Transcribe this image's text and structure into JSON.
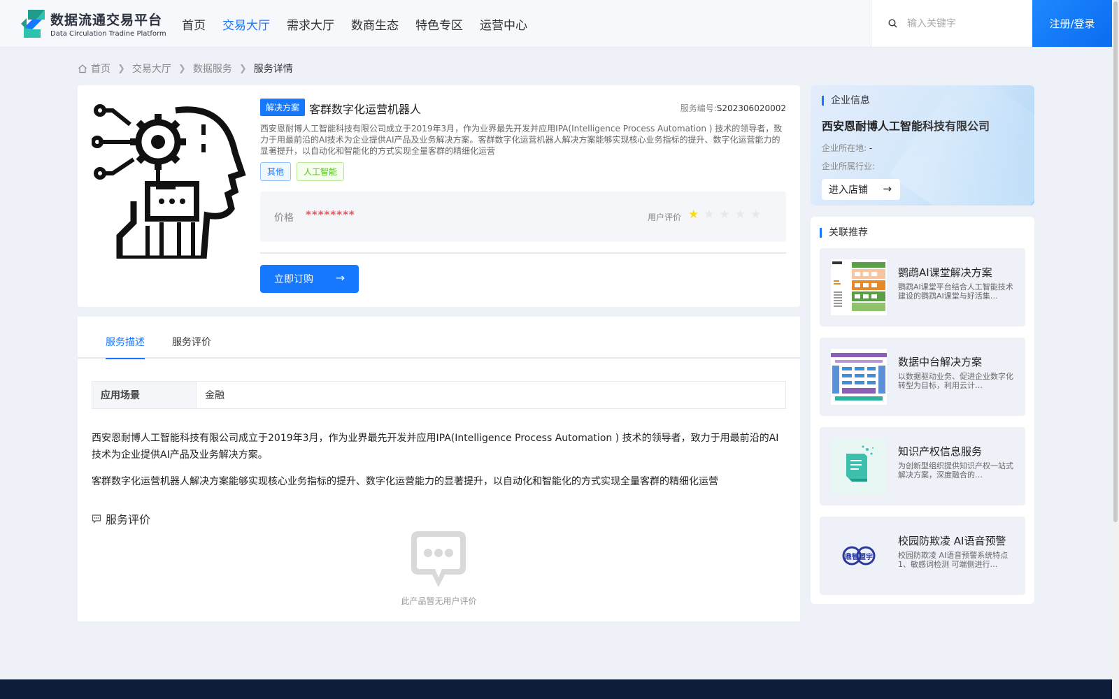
{
  "header": {
    "logo_cn": "数据流通交易平台",
    "logo_en": "Data Circulation Tradine Platform",
    "nav": [
      {
        "label": "首页"
      },
      {
        "label": "交易大厅"
      },
      {
        "label": "需求大厅"
      },
      {
        "label": "数商生态"
      },
      {
        "label": "特色专区"
      },
      {
        "label": "运营中心"
      }
    ],
    "active_nav": "交易大厅",
    "search_placeholder": "输入关键字",
    "login_label": "注册/登录"
  },
  "breadcrumb": [
    "首页",
    "交易大厅",
    "数据服务",
    "服务详情"
  ],
  "product": {
    "tag": "解决方案",
    "title": "客群数字化运营机器人",
    "code_label": "服务编号:",
    "code": "S202306020002",
    "description": "西安恩耐博人工智能科技有限公司成立于2019年3月，作为业界最先开发并应用IPA(Intelligence Process Automation ) 技术的领导者，致力于用最前沿的AI技术为企业提供AI产品及业务解决方案。客群数字化运营机器人解决方案能够实现核心业务指标的提升、数字化运营能力的显著提升，以自动化和智能化的方式实现全量客群的精细化运营",
    "chips": [
      "其他",
      "人工智能"
    ],
    "price_label": "价格",
    "price_value": "********",
    "rating_label": "用户评价",
    "rating": 1,
    "rating_max": 5,
    "buy_label": "立即订购",
    "image_icon": "ai-robot-head-gear-icon"
  },
  "tabs": [
    {
      "label": "服务描述"
    },
    {
      "label": "服务评价"
    }
  ],
  "details": {
    "scene_key": "应用场景",
    "scene_value": "金融",
    "para1": "西安恩耐博人工智能科技有限公司成立于2019年3月，作为业界最先开发并应用IPA(Intelligence Process Automation ) 技术的领导者，致力于用最前沿的AI技术为企业提供AI产品及业务解决方案。",
    "para2": "客群数字化运营机器人解决方案能够实现核心业务指标的提升、数字化运营能力的显著提升，以自动化和智能化的方式实现全量客群的精细化运营",
    "review_title": "服务评价",
    "empty_text": "此产品暂无用户评价"
  },
  "company": {
    "section_title": "企业信息",
    "name": "西安恩耐博人工智能科技有限公司",
    "location_label": "企业所在地:",
    "location_value": "-",
    "industry_label": "企业所属行业:",
    "industry_value": "",
    "enter_label": "进入店铺"
  },
  "recommend": {
    "section_title": "关联推荐",
    "items": [
      {
        "name": "鹦鹉AI课堂解决方案",
        "desc": "鹦鹉AI课堂平台结合人工智能技术建设的鹦鹉AI课堂与好活集…"
      },
      {
        "name": "数据中台解决方案",
        "desc": "以数据驱动业务、促进企业数字化转型为目标，利用云计…"
      },
      {
        "name": "知识产权信息服务",
        "desc": "为创新型组织提供知识产权一站式解决方案，深度融合的…"
      },
      {
        "name": "校园防欺凌 AI语音预警",
        "desc": "校园防欺凌 AI语音预警系统特点1、敏感词检测 可端侧进行…"
      }
    ],
    "thumb4_text": "鼎智盟宇"
  },
  "colors": {
    "accent": "#1677ff",
    "price": "#ff4d4f",
    "star": "#fadb14",
    "footer": "#0f1c3a"
  }
}
